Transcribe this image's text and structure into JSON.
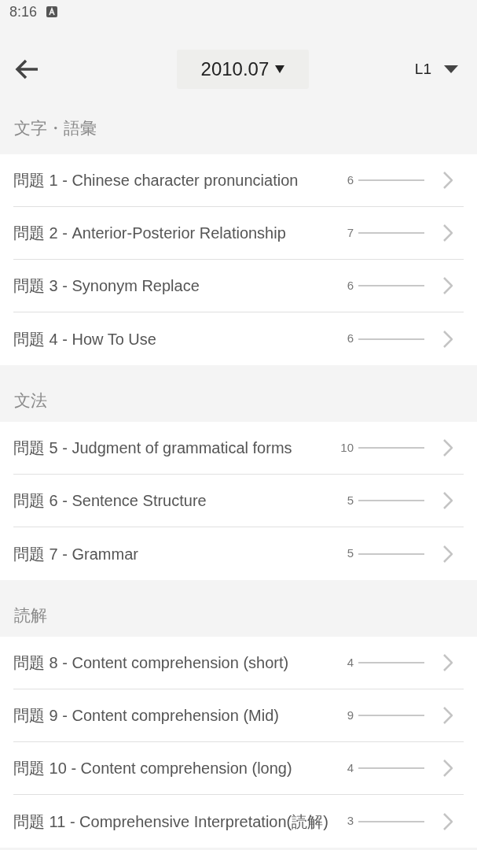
{
  "status_bar": {
    "time": "8:16"
  },
  "header": {
    "date": "2010.07",
    "level": "L1"
  },
  "sections": [
    {
      "title": "文字・語彙",
      "items": [
        {
          "number": "問題 1",
          "title": "- Chinese character pronunciation",
          "count": "6"
        },
        {
          "number": "問題 2",
          "title": "- Anterior-Posterior Relationship",
          "count": "7"
        },
        {
          "number": "問題 3",
          "title": "- Synonym Replace",
          "count": "6"
        },
        {
          "number": "問題 4",
          "title": "- How To Use",
          "count": "6"
        }
      ]
    },
    {
      "title": "文法",
      "items": [
        {
          "number": "問題 5",
          "title": "- Judgment of grammatical forms",
          "count": "10"
        },
        {
          "number": "問題 6",
          "title": "- Sentence Structure",
          "count": "5"
        },
        {
          "number": "問題 7",
          "title": "- Grammar",
          "count": "5"
        }
      ]
    },
    {
      "title": "読解",
      "items": [
        {
          "number": "問題 8",
          "title": "- Content comprehension (short)",
          "count": "4"
        },
        {
          "number": "問題 9",
          "title": "- Content comprehension (Mid)",
          "count": "9"
        },
        {
          "number": "問題 10",
          "title": "- Content comprehension (long)",
          "count": "4"
        },
        {
          "number": "問題 11",
          "title": "- Comprehensive Interpretation(読解)",
          "count": "3"
        }
      ]
    }
  ]
}
